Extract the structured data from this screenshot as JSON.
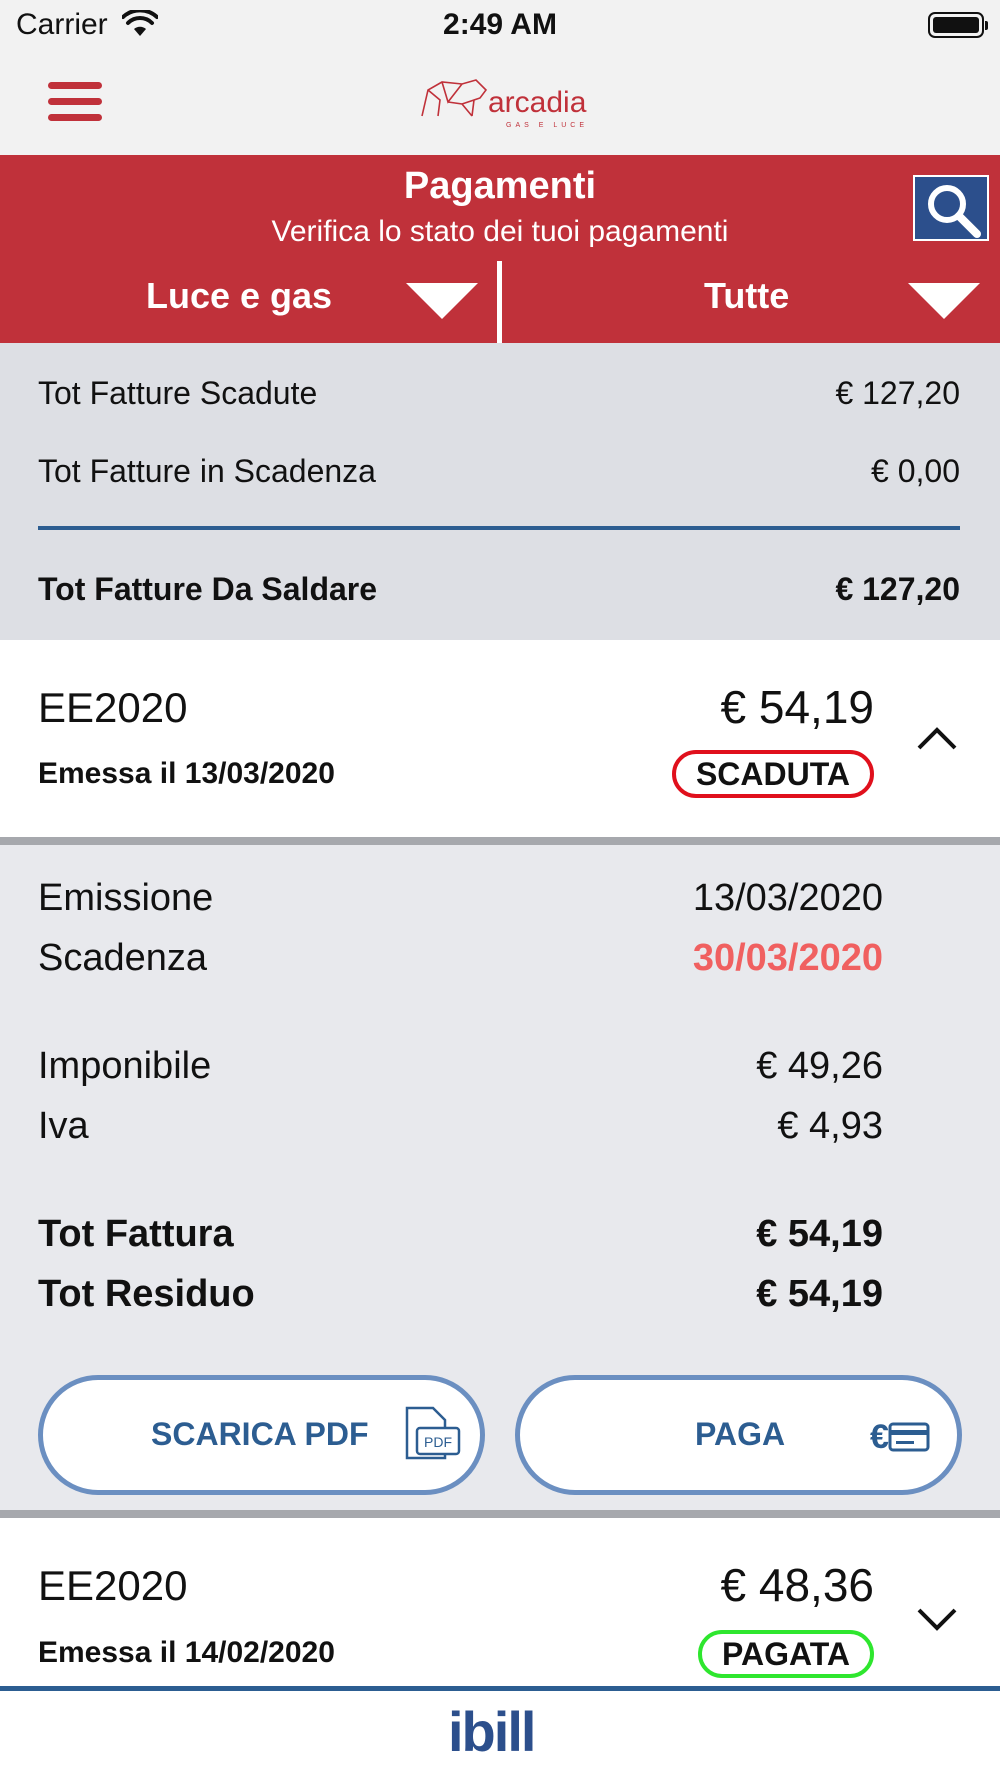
{
  "status_bar": {
    "carrier": "Carrier",
    "time": "2:49 AM"
  },
  "nav": {
    "logo_text": "arcadia",
    "logo_sub": "GAS E LUCE"
  },
  "header": {
    "title": "Pagamenti",
    "subtitle": "Verifica lo stato dei tuoi pagamenti",
    "filter_service": "Luce e gas",
    "filter_status": "Tutte"
  },
  "summary": {
    "expired_label": "Tot Fatture Scadute",
    "expired_value": "€ 127,20",
    "due_label": "Tot Fatture in Scadenza",
    "due_value": "€ 0,00",
    "total_label": "Tot Fatture Da Saldare",
    "total_value": "€ 127,20"
  },
  "invoices": [
    {
      "code": "EE2020",
      "amount": "€ 54,19",
      "issued": "Emessa il 13/03/2020",
      "status": "SCADUTA",
      "details": {
        "emission_label": "Emissione",
        "emission_value": "13/03/2020",
        "due_label": "Scadenza",
        "due_value": "30/03/2020",
        "taxable_label": "Imponibile",
        "taxable_value": "€ 49,26",
        "vat_label": "Iva",
        "vat_value": "€ 4,93",
        "total_label": "Tot Fattura",
        "total_value": "€ 54,19",
        "residual_label": "Tot Residuo",
        "residual_value": "€ 54,19"
      },
      "buttons": {
        "pdf": "SCARICA PDF",
        "pay": "PAGA"
      }
    },
    {
      "code": "EE2020",
      "amount": "€ 48,36",
      "issued": "Emessa il 14/02/2020",
      "status": "PAGATA"
    }
  ],
  "footer": {
    "brand": "ibill"
  },
  "colors": {
    "brand_red": "#c0313a",
    "brand_blue": "#2c5d91",
    "status_expired": "#e0101c",
    "status_paid": "#2ee62e"
  }
}
